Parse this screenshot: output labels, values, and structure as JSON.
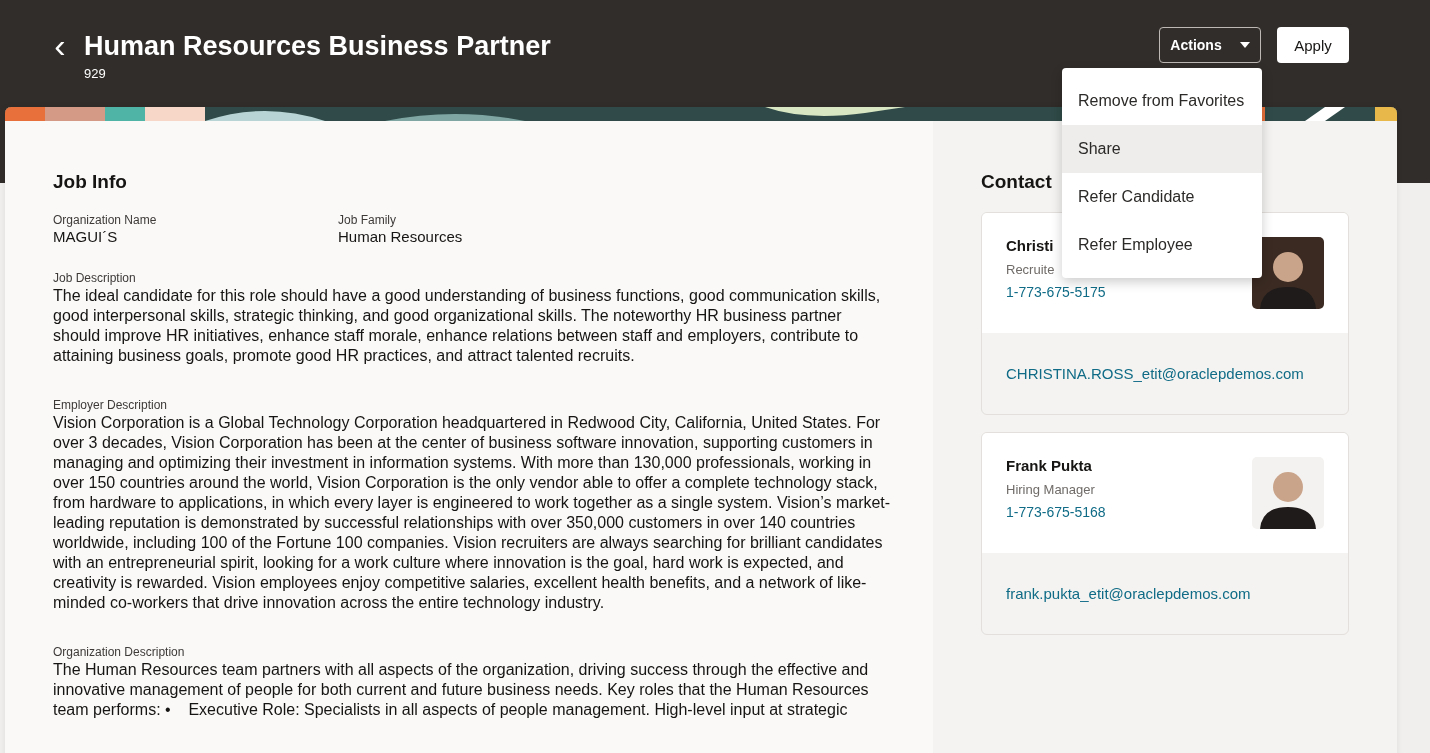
{
  "header": {
    "back_label": "‹",
    "title": "Human Resources Business Partner",
    "subtitle": "929"
  },
  "actions_button": {
    "label": "Actions",
    "expanded": true
  },
  "apply_button": {
    "label": "Apply"
  },
  "actions_menu": [
    {
      "label": "Remove from Favorites",
      "selected": false
    },
    {
      "label": "Share",
      "selected": true
    },
    {
      "label": "Refer Candidate",
      "selected": false
    },
    {
      "label": "Refer Employee",
      "selected": false
    }
  ],
  "job_info": {
    "title": "Job Info",
    "fields": [
      {
        "label": "Organization Name",
        "value": "MAGUI´S"
      },
      {
        "label": "Job Family",
        "value": "Human Resources"
      }
    ],
    "sections": [
      {
        "label": "Job Description",
        "text": "The ideal candidate for this role should have a good understanding of business functions, good communication skills, good interpersonal skills, strategic thinking, and good organizational skills. The noteworthy HR business partner should improve HR initiatives, enhance staff morale, enhance relations between staff and employers, contribute to attaining business goals, promote good HR practices, and attract talented recruits."
      },
      {
        "label": "Employer Description",
        "text": "Vision Corporation is a Global Technology Corporation headquartered in Redwood City, California, United States. For over 3 decades, Vision Corporation has been at the center of business software innovation, supporting customers in managing and optimizing their investment in information systems. With more than 130,000 professionals, working in over 150 countries around the world, Vision Corporation is the only vendor able to offer a complete technology stack, from hardware to applications, in which every layer is engineered to work together as a single system. Vision’s market-leading reputation is demonstrated by successful relationships with over 350,000 customers in over 140 countries worldwide, including 100 of the Fortune 100 companies. Vision recruiters are always searching for brilliant candidates with an entrepreneurial spirit, looking for a work culture where innovation is the goal, hard work is expected, and creativity is rewarded. Vision employees enjoy competitive salaries, excellent health benefits, and a network of like-minded co-workers that drive innovation across the entire technology industry."
      },
      {
        "label": "Organization Description",
        "text": "The Human Resources team partners with all aspects of the organization, driving success through the effective and innovative management of people for both current and future business needs. Key roles that the Human Resources team performs: •    Executive Role: Specialists in all aspects of people management. High-level input at strategic"
      }
    ]
  },
  "contacts": {
    "title": "Contact",
    "items": [
      {
        "name": "Christi",
        "role": "Recruite",
        "phone": "1-773-675-5175",
        "email": "CHRISTINA.ROSS_etit@oraclepdemos.com"
      },
      {
        "name": "Frank Pukta",
        "role": "Hiring Manager",
        "phone": "1-773-675-5168",
        "email": "frank.pukta_etit@oraclepdemos.com"
      }
    ]
  }
}
